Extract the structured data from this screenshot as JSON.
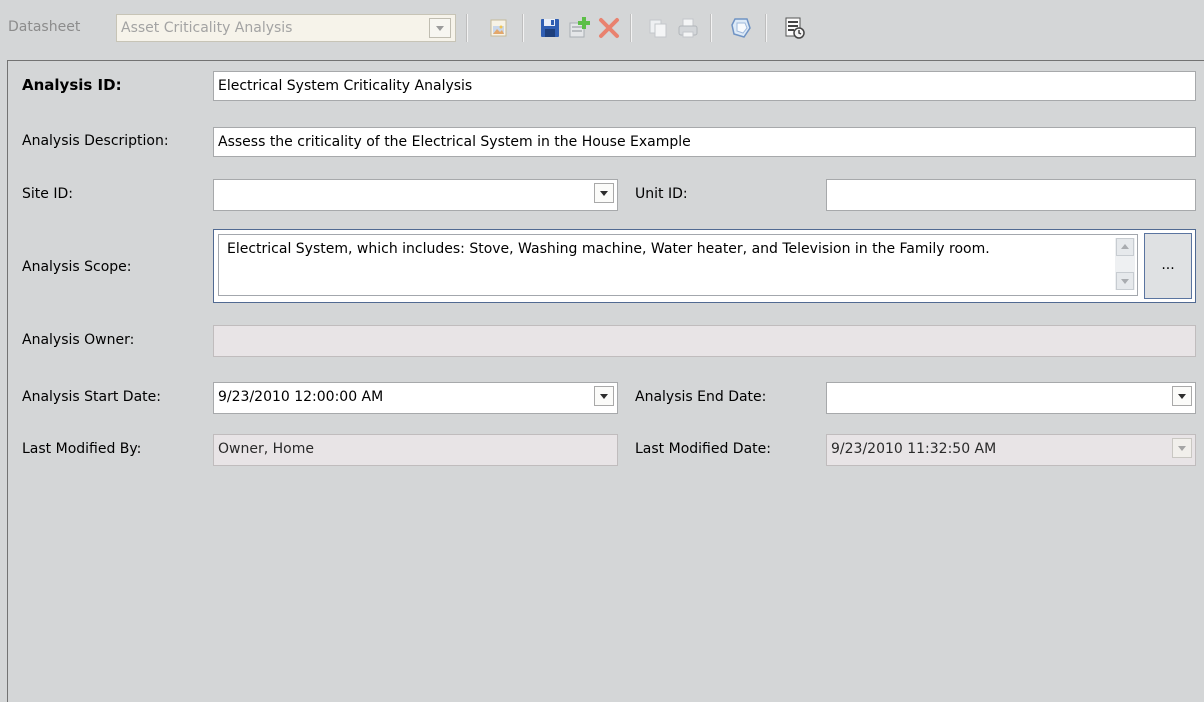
{
  "toolbar": {
    "datasheet_label": "Datasheet",
    "datasheet_selected": "Asset Criticality Analysis",
    "icons": [
      "image-icon",
      "save-icon",
      "new-record-icon",
      "delete-icon",
      "copy-icon",
      "print-icon",
      "tag-icon",
      "report-icon"
    ]
  },
  "form": {
    "analysis_id_label": "Analysis ID:",
    "analysis_id_value": "Electrical System Criticality Analysis",
    "description_label": "Analysis Description:",
    "description_value": "Assess the criticality of the Electrical System in the House Example",
    "site_id_label": "Site ID:",
    "site_id_value": "",
    "unit_id_label": "Unit ID:",
    "unit_id_value": "",
    "scope_label": "Analysis Scope:",
    "scope_value": "Electrical System, which includes: Stove, Washing machine, Water heater, and Television in the Family room.",
    "scope_button": "...",
    "owner_label": "Analysis Owner:",
    "owner_value": "",
    "start_date_label": "Analysis Start Date:",
    "start_date_value": "9/23/2010 12:00:00 AM",
    "end_date_label": "Analysis End Date:",
    "end_date_value": "",
    "modified_by_label": "Last Modified By:",
    "modified_by_value": "Owner, Home",
    "modified_date_label": "Last Modified Date:",
    "modified_date_value": "9/23/2010 11:32:50 AM"
  },
  "colors": {
    "background": "#d4d6d7",
    "disabled_field": "#e8e4e6",
    "focus_border": "#516a92"
  }
}
